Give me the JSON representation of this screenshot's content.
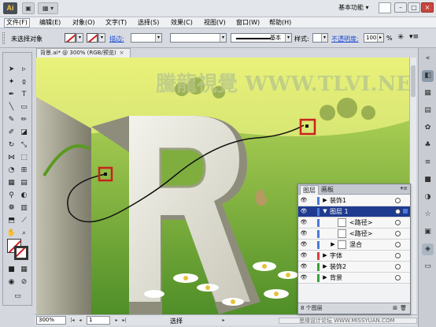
{
  "titlebar": {
    "app_logo": "Ai",
    "bridge_icon": "bridge-icon",
    "arrange_icon": "arrange-documents-icon",
    "workspace": "基本功能"
  },
  "menu": {
    "items": [
      "文件(F)",
      "编辑(E)",
      "对象(O)",
      "文字(T)",
      "选择(S)",
      "效果(C)",
      "视图(V)",
      "窗口(W)",
      "帮助(H)"
    ]
  },
  "control_bar": {
    "selection_status": "未选择对象",
    "stroke_label": "描边:",
    "stroke_profile": "基本",
    "style_label": "样式:",
    "opacity_label": "不透明度:",
    "opacity_value": "100",
    "opacity_unit": "%"
  },
  "document": {
    "tab_title": "背景.ai* @ 300% (RGB/预览)",
    "tab_close": "×",
    "watermark": "騰龍視覺 WWW.TLVI.NET"
  },
  "status_bar": {
    "zoom": "300%",
    "page": "1",
    "status": "选择"
  },
  "layers_panel": {
    "tabs": [
      "图层",
      "画板"
    ],
    "menu_icon": "panel-menu-icon",
    "rows": [
      {
        "name": "装饰1",
        "indent": 0,
        "expander": "▶",
        "thumb": false,
        "color": "#4a7bd8",
        "selected": false
      },
      {
        "name": "图层 1",
        "indent": 0,
        "expander": "▼",
        "thumb": false,
        "color": "#4a7bd8",
        "selected": true
      },
      {
        "name": "<路径>",
        "indent": 1,
        "expander": "",
        "thumb": true,
        "color": "#4a7bd8",
        "selected": false
      },
      {
        "name": "<路径>",
        "indent": 1,
        "expander": "",
        "thumb": true,
        "color": "#4a7bd8",
        "selected": false
      },
      {
        "name": "混合",
        "indent": 1,
        "expander": "▶",
        "thumb": true,
        "color": "#4a7bd8",
        "selected": false
      },
      {
        "name": "字体",
        "indent": 0,
        "expander": "▶",
        "thumb": false,
        "color": "#d94141",
        "selected": false
      },
      {
        "name": "装饰2",
        "indent": 0,
        "expander": "▶",
        "thumb": false,
        "color": "#3aa13a",
        "selected": false
      },
      {
        "name": "背景",
        "indent": 0,
        "expander": "▶",
        "thumb": false,
        "color": "#3aa13a",
        "selected": false
      }
    ],
    "footer": "8 个图层"
  },
  "footer_watermark": "思缘设计论坛 WWW.MISSYUAN.COM",
  "colors": {
    "accent": "#1f3b8f",
    "anchor_highlight": "#c8221c",
    "link": "#1d4bd1"
  }
}
